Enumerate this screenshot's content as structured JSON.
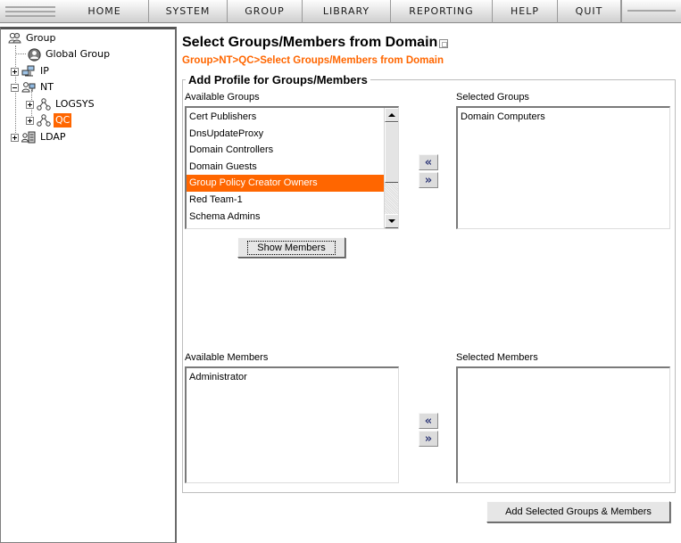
{
  "menu": {
    "items": [
      "HOME",
      "SYSTEM",
      "GROUP",
      "LIBRARY",
      "REPORTING",
      "HELP",
      "QUIT"
    ]
  },
  "tree": {
    "root": "Group",
    "global_group": "Global Group",
    "ip": "IP",
    "nt": "NT",
    "logsys": "LOGSYS",
    "qc": "QC",
    "ldap": "LDAP",
    "selected": "QC"
  },
  "page": {
    "title": "Select Groups/Members from Domain",
    "breadcrumb": "Group>NT>QC>Select Groups/Members from Domain",
    "fieldset_legend": "Add Profile for Groups/Members"
  },
  "groups": {
    "available_label": "Available Groups",
    "available": [
      "Cert Publishers",
      "DnsUpdateProxy",
      "Domain Controllers",
      "Domain Guests",
      "Group Policy Creator Owners",
      "Red Team-1",
      "Schema Admins"
    ],
    "available_selected": "Group Policy Creator Owners",
    "selected_label": "Selected Groups",
    "selected": [
      "Domain Computers"
    ],
    "add_symbol": "«",
    "remove_symbol": "»"
  },
  "show_members_label": "Show Members",
  "members": {
    "available_label": "Available Members",
    "available": [
      "Administrator"
    ],
    "selected_label": "Selected Members",
    "selected": [],
    "add_symbol": "«",
    "remove_symbol": "»"
  },
  "submit_label": "Add Selected Groups & Members",
  "colors": {
    "accent": "#ff6600",
    "arrow": "#333c7a"
  }
}
